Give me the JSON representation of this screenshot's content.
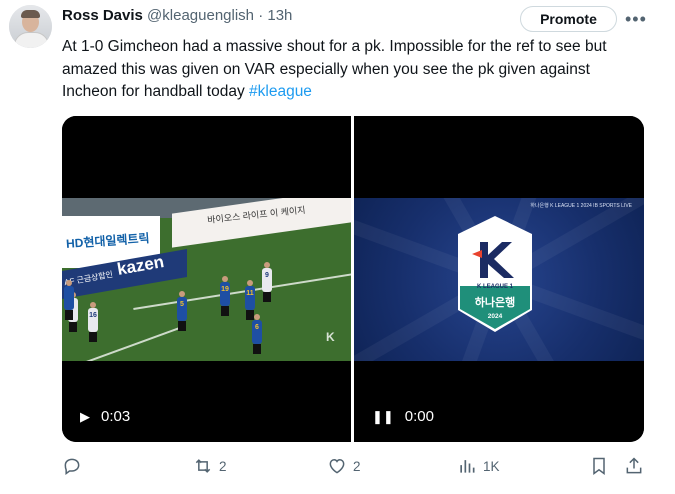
{
  "author": {
    "name": "Ross Davis",
    "handle": "@kleaguenglish",
    "separator": "·",
    "time": "13h"
  },
  "header_actions": {
    "promote_label": "Promote",
    "more_label": "•••"
  },
  "tweet": {
    "text": "At 1-0 Gimcheon had a massive shout for a pk. Impossible for the ref to see but amazed this was given on VAR especially when you see the pk given against Incheon for handball today",
    "hashtag": "#kleague"
  },
  "media": {
    "left_video": {
      "state_icon": "play-icon",
      "time": "0:03",
      "scene_text": {
        "board_main": "바이오스 라이프 이 케이지",
        "board_hd": "HD현대일렉트릭",
        "board_kazen": "kazen",
        "board_small": "AF 근금상합인",
        "watermark": "K"
      }
    },
    "right_video": {
      "state_icon": "pause-icon",
      "time": "0:00",
      "scene_text": {
        "broadcast": "하나은행 K LEAGUE 1 2024  IB SPORTS LIVE",
        "badge_league": "K LEAGUE 1",
        "badge_sponsor": "하나은행",
        "badge_year": "2024"
      }
    }
  },
  "stats": {
    "replies": "",
    "reposts": "2",
    "likes": "2",
    "views": "1K"
  },
  "colors": {
    "link": "#1d9bf0",
    "muted": "#536471",
    "text": "#0f1419",
    "badge_green": "#1f8f7a",
    "badge_red": "#e8432e"
  }
}
